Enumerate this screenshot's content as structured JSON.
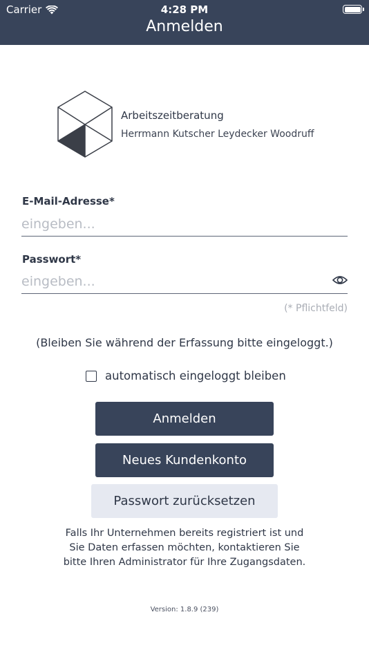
{
  "status_bar": {
    "carrier": "Carrier",
    "time": "4:28 PM"
  },
  "nav": {
    "title": "Anmelden"
  },
  "brand": {
    "title": "Arbeitszeitberatung",
    "subtitle": "Herrmann Kutscher Leydecker Woodruff"
  },
  "form": {
    "email_label": "E-Mail-Adresse*",
    "email_placeholder": "eingeben...",
    "email_value": "",
    "password_label": "Passwort*",
    "password_placeholder": "eingeben...",
    "password_value": "",
    "required_hint": "(* Pflichtfeld)",
    "stay_logged_notice": "(Bleiben Sie während der Erfassung bitte eingeloggt.)",
    "remember_label": "automatisch eingeloggt bleiben",
    "remember_checked": false
  },
  "buttons": {
    "login": "Anmelden",
    "new_account": "Neues Kundenkonto",
    "reset_password": "Passwort zurücksetzen"
  },
  "info": {
    "line1": "Falls Ihr Unternehmen bereits registriert ist und",
    "line2": "Sie Daten erfassen möchten, kontaktieren Sie",
    "line3": "bitte Ihren Administrator für Ihre Zugangsdaten."
  },
  "version": "Version: 1.8.9 (239)",
  "icons": {
    "wifi": "wifi-icon",
    "battery": "battery-icon",
    "logo": "cube-logo",
    "password_toggle": "eye-icon",
    "checkbox": "checkbox-icon"
  },
  "colors": {
    "header_bg": "#38445a",
    "primary_button": "#38445a",
    "secondary_button": "#e6e9f1",
    "text": "#2f3747",
    "placeholder": "#b8bcc4"
  }
}
